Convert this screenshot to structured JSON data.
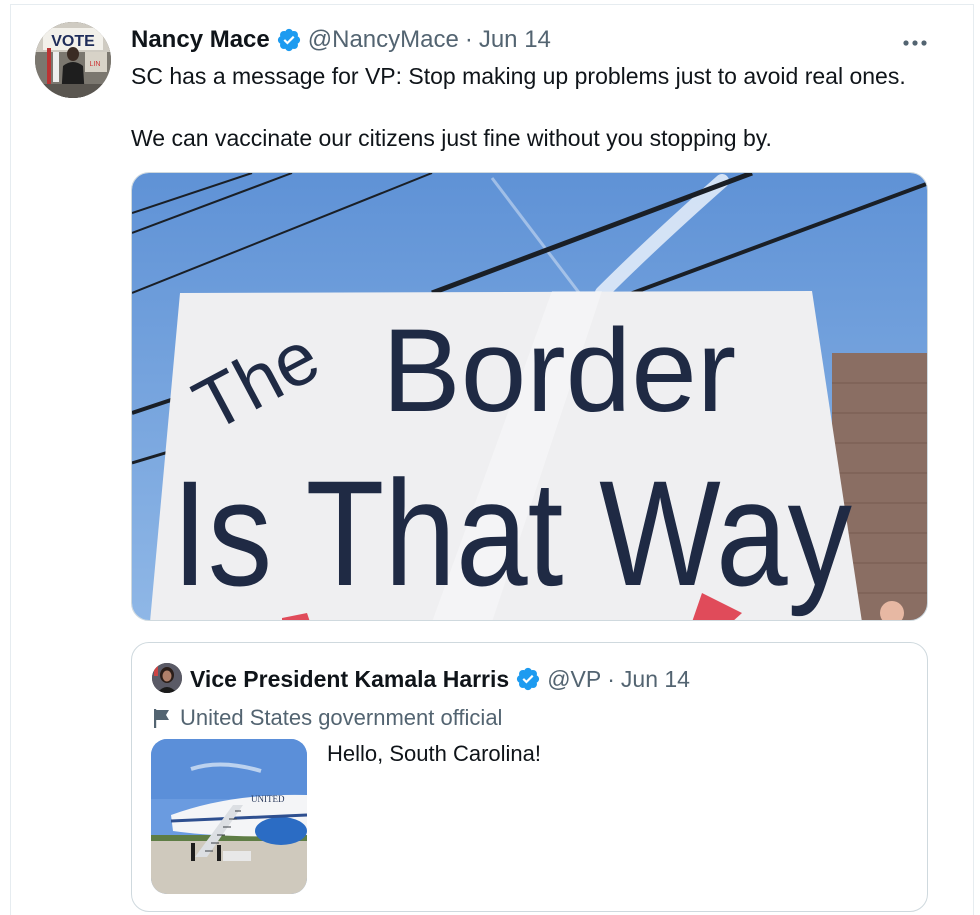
{
  "tweet": {
    "author_name": "Nancy Mace",
    "handle": "@NancyMace",
    "separator": "·",
    "date": "Jun 14",
    "more_icon": "more-horizontal-icon",
    "text_line1": "SC has a message for VP: Stop making up problems just to avoid real ones.",
    "text_line2": "We can vaccinate our citizens just fine without you stopping by.",
    "avatar_sign_text": "VOTE",
    "image_sign": {
      "word1": "The",
      "word2": "Border",
      "word3": "Is That Way"
    }
  },
  "quoted_tweet": {
    "author_name": "Vice President Kamala Harris",
    "handle": "@VP",
    "separator": "·",
    "date": "Jun 14",
    "label": "United States government official",
    "text": "Hello, South Carolina!",
    "plane_text": "UNITED"
  },
  "colors": {
    "verified": "#1d9bf0",
    "secondary_text": "#536471",
    "border": "#cfd9de"
  }
}
